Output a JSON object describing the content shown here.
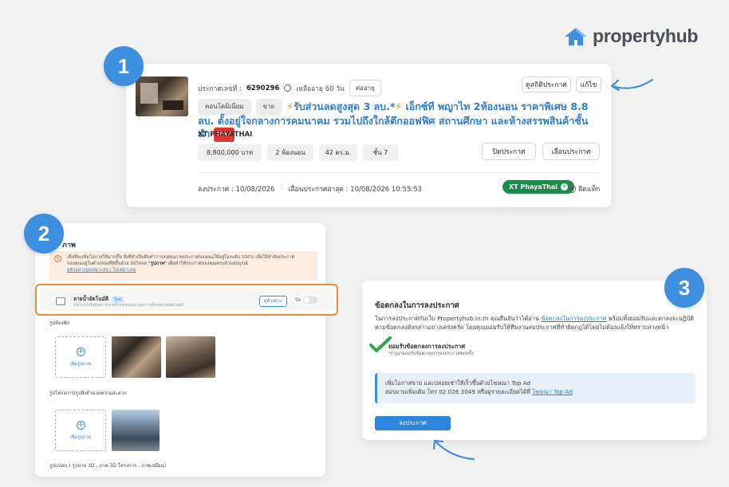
{
  "brand": {
    "name": "propertyhub",
    "color": "#4a4f58",
    "accent": "#3d8fe0"
  },
  "steps": [
    "1",
    "2",
    "3"
  ],
  "listing": {
    "id_label": "ประกาศเลขที่ :",
    "id_value": "6290296",
    "remaining": "เหลืออายุ 60 วัน",
    "extend_label": "ต่ออายุ",
    "stats_button": "ดูสถิติประกาศ",
    "edit_button": "แก้ไข",
    "property_type": "คอนโดมิเนียม",
    "deal_type": "ขาย",
    "title_part1": "รับส่วนลดสูงสุด 3 ลบ.*",
    "title_part2": "เอ็กซ์ที พญาไท 2ห้องนอน ราคาพิเศษ 8.8 ลบ. ตั้งอยู่ใจกลางการคมนาคม รวมไปถึงใกล้ตึกออฟฟิศ สถานศึกษา และห้างสรรพสินค้าชั้นนำ",
    "new_badge": "NEW",
    "project": "XT PHAYATHAI",
    "price": "8,800,000 บาท",
    "bedrooms": "2 ห้องนอน",
    "area": "42 ตร.ม.",
    "floor": "ชั้น 7",
    "close_button": "ปิดประกาศ",
    "bump_button": "เลื่อนประกาศ",
    "posted": "ลงประกาศ : 10/08/2026",
    "updated": "เลื่อนประกาศล่าสุด : 10/08/2026 10:55:53",
    "location_tag": "XT PhayaThai",
    "add_tag": "ติดแท็ก"
  },
  "photos": {
    "title": "ภาพ",
    "notice_line1": "เพื่อที่จะเพิ่มโอกาสให้มากขึ้น สิ่งที่ทำเป็นคือทำการลงคุณภาพประกาศของคุณให้อยู่ในระดับ 100% เพื่อให้ลำดับประกาศ",
    "notice_line2a": "ของคุณอยู่ในตำแหน่งที่ดีขึ้นด้วย อัปโหลด",
    "notice_bold": "\"รูปภาพ\"",
    "notice_line2b": "เพื่อทำให้ประกาศของคุณครบถ้วนสมบูรณ์",
    "notice_link": "ดูตัวอย่างรูปเหมาะสม / ไม่เหมาะสม",
    "watermark_title": "ลายน้ำอัตโนมัติ",
    "watermark_new": "ใหม่",
    "watermark_sub": "เพิ่มโลโก้หรือข้อความลายน้ำของคุณลงบนรูปภาพทั้งหมดโดยอัตโนมัติ",
    "watermark_example": "ดูตัวอย่าง",
    "watermark_toggle_label": "ปิด",
    "room_label": "รูปห้องพัก",
    "upload_label": "เพิ่มรูปภาพ",
    "project_label": "รูปโครงการ/รูปสิ่งอำนวยความสะดวก",
    "plan_label": "รูปแปลน ( รูปถ่าย 3D , ภาพ 3D โครงการ , ภาพเสมือน)"
  },
  "terms": {
    "title": "ข้อตกลงในการลงประกาศ",
    "text_a": "ในการลงประกาศกับเว็บ Propertyhub.in.th คุณยืนยันว่าได้อ่าน",
    "text_link": "ข้อตกลงในการลงประกาศ",
    "text_b": "พร้อมทั้งยอมรับและตกลงจะปฏิบัติตามข้อตกลงดังกล่าวอย่างเคร่งครัด โดยคุณยอมรับให้ทีมงานลบประกาศที่ทำผิดกฎได้โดยไม่ต้องแจ้งให้ทราบล่วงหน้า",
    "accept_title": "ยอมรับข้อตกลงการลงประกาศ",
    "accept_sub": "*กรุณายอมรับข้อตกลงการลงประกาศทุกครั้ง",
    "topad_line1": "เพิ่มโอกาสขาย และปล่อยเช่าให้เร็วขึ้นด้วยโฆษณา Top Ad",
    "topad_line2": "สอบถามเพิ่มเติม โทร 02 026 3049 หรือดูรายละเอียดได้ที่",
    "topad_link": "โฆษณา Top Ad",
    "post_button": "ลงประกาศ"
  },
  "colors": {
    "step_blue": "#3d8fe0",
    "highlight_orange": "#e98c3f",
    "tag_green": "#1f8a4c",
    "check_green": "#2ea44f",
    "link_blue": "#2f7fd2"
  }
}
